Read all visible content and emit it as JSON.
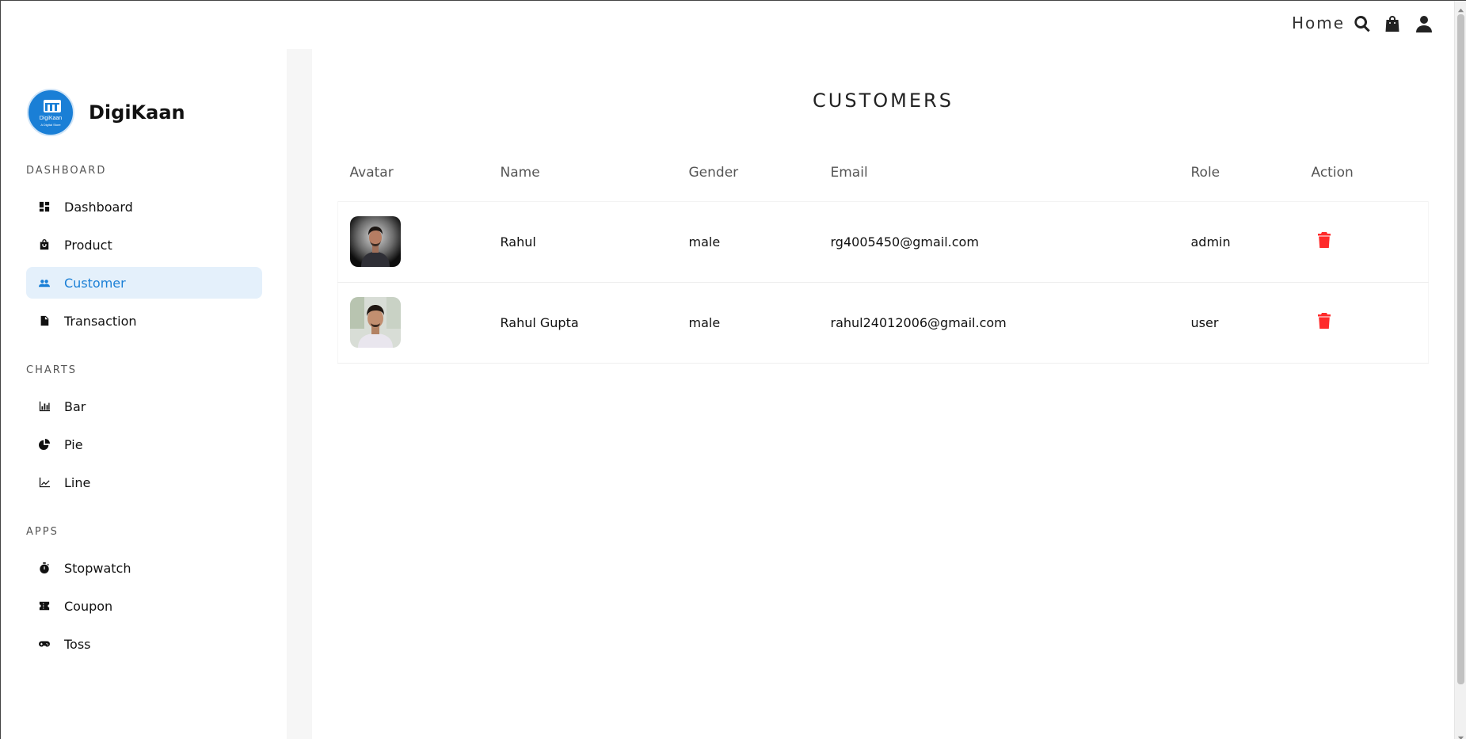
{
  "nav": {
    "home_label": "Home",
    "search_icon": "search-icon",
    "bag_icon": "shopping-bag-icon",
    "user_icon": "user-icon"
  },
  "brand": {
    "name": "DigiKaan",
    "logo_text": "DigiKaan",
    "logo_subtext": "A Digital Store",
    "accent_color": "#1a7fd6"
  },
  "sidebar": {
    "sections": [
      {
        "title": "DASHBOARD",
        "items": [
          {
            "label": "Dashboard",
            "icon": "dashboard-icon",
            "active": false
          },
          {
            "label": "Product",
            "icon": "shopping-bag-icon",
            "active": false
          },
          {
            "label": "Customer",
            "icon": "people-icon",
            "active": true
          },
          {
            "label": "Transaction",
            "icon": "document-icon",
            "active": false
          }
        ]
      },
      {
        "title": "CHARTS",
        "items": [
          {
            "label": "Bar",
            "icon": "bar-chart-icon",
            "active": false
          },
          {
            "label": "Pie",
            "icon": "pie-chart-icon",
            "active": false
          },
          {
            "label": "Line",
            "icon": "line-chart-icon",
            "active": false
          }
        ]
      },
      {
        "title": "APPS",
        "items": [
          {
            "label": "Stopwatch",
            "icon": "stopwatch-icon",
            "active": false
          },
          {
            "label": "Coupon",
            "icon": "coupon-icon",
            "active": false
          },
          {
            "label": "Toss",
            "icon": "gamepad-icon",
            "active": false
          }
        ]
      }
    ]
  },
  "main": {
    "title": "CUSTOMERS",
    "columns": [
      "Avatar",
      "Name",
      "Gender",
      "Email",
      "Role",
      "Action"
    ],
    "rows": [
      {
        "avatar": "avatar-photo",
        "name": "Rahul",
        "gender": "male",
        "email": "rg4005450@gmail.com",
        "role": "admin",
        "action_icon": "trash-icon"
      },
      {
        "avatar": "avatar-photo",
        "name": "Rahul Gupta",
        "gender": "male",
        "email": "rahul24012006@gmail.com",
        "role": "user",
        "action_icon": "trash-icon"
      }
    ],
    "delete_color": "#ff2b2b"
  }
}
